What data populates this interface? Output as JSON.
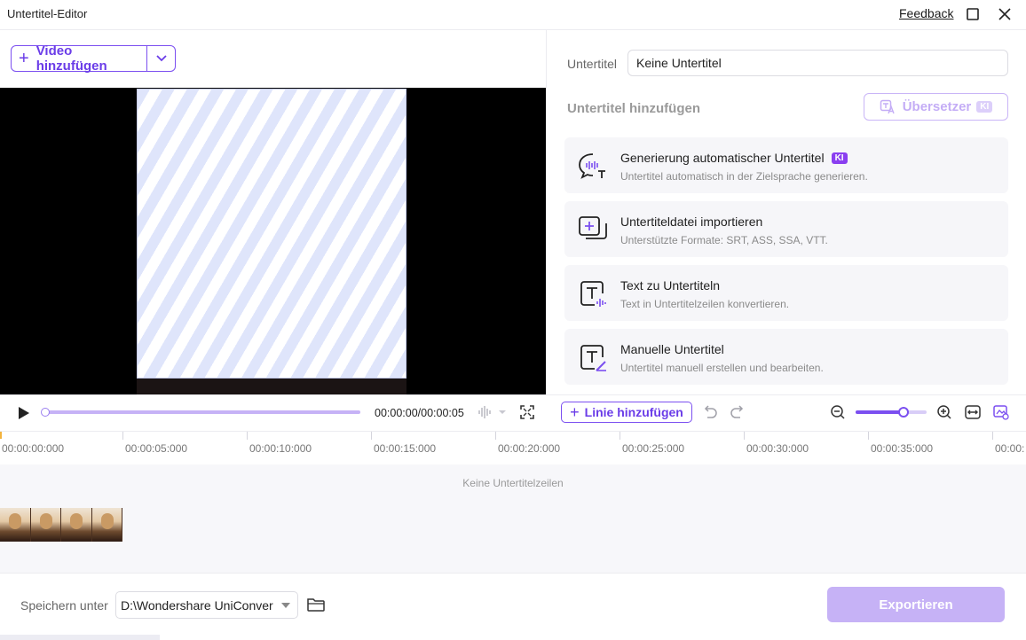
{
  "window": {
    "title": "Untertitel-Editor",
    "feedback_label": "Feedback"
  },
  "left_pane": {
    "add_video_label": "Video hinzufügen"
  },
  "right_pane": {
    "subtitle_label": "Untertitel",
    "subtitle_value": "Keine Untertitel",
    "add_subtitles_title": "Untertitel hinzufügen",
    "translator_label": "Übersetzer",
    "translator_badge": "KI",
    "cards": [
      {
        "title": "Generierung automatischer Untertitel",
        "badge": "KI",
        "desc": "Untertitel automatisch in der Zielsprache generieren.",
        "icon": "auto-subtitle-icon"
      },
      {
        "title": "Untertiteldatei importieren",
        "desc": "Unterstützte Formate: SRT, ASS, SSA, VTT.",
        "icon": "import-file-icon"
      },
      {
        "title": "Text zu Untertiteln",
        "desc": "Text in Untertitelzeilen konvertieren.",
        "icon": "text-to-subtitle-icon"
      },
      {
        "title": "Manuelle Untertitel",
        "desc": "Untertitel manuell erstellen und bearbeiten.",
        "icon": "manual-subtitle-icon"
      }
    ]
  },
  "player": {
    "timecode": "00:00:00/00:00:05",
    "progress": 0
  },
  "editor_toolbar": {
    "add_line_label": "Linie hinzufügen",
    "zoom_level": 0.68
  },
  "timeline": {
    "ticks": [
      "00:00:00:000",
      "00:00:05:000",
      "00:00:10:000",
      "00:00:15:000",
      "00:00:20:000",
      "00:00:25:000",
      "00:00:30:000",
      "00:00:35:000",
      "00:00:"
    ],
    "empty_text": "Keine Untertitelzeilen"
  },
  "footer": {
    "save_label": "Speichern unter",
    "save_path": "D:\\Wondershare UniConver",
    "export_label": "Exportieren"
  },
  "colors": {
    "accent": "#6a3ce8",
    "accent_light": "#c6b2f6",
    "badge": "#8a3ff0"
  }
}
